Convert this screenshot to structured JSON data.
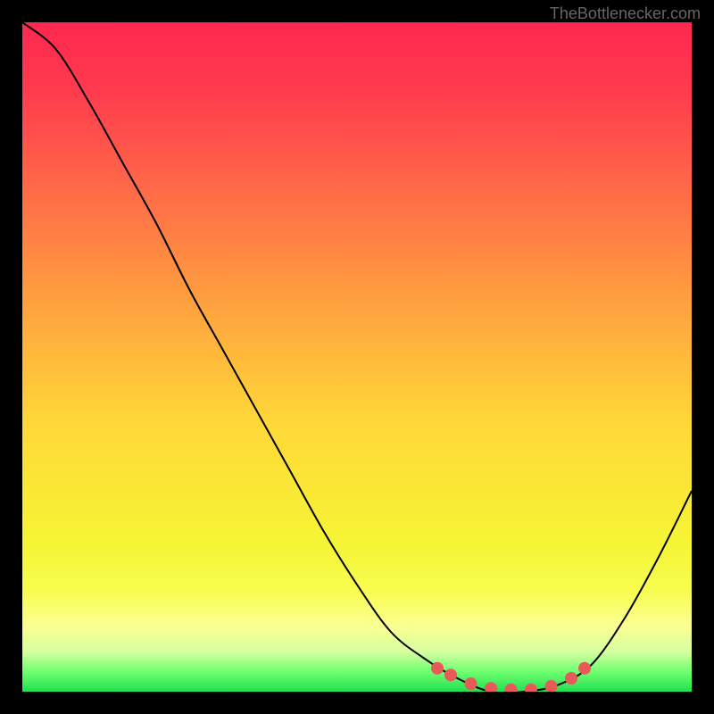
{
  "watermark": "TheBottlenecker.com",
  "chart_data": {
    "type": "line",
    "title": "",
    "xlabel": "",
    "ylabel": "",
    "xlim": [
      0,
      100
    ],
    "ylim": [
      0,
      100
    ],
    "series": [
      {
        "name": "bottleneck-curve",
        "points": [
          {
            "x": 0,
            "y": 100
          },
          {
            "x": 5,
            "y": 96
          },
          {
            "x": 10,
            "y": 88
          },
          {
            "x": 15,
            "y": 79
          },
          {
            "x": 20,
            "y": 70
          },
          {
            "x": 25,
            "y": 60
          },
          {
            "x": 30,
            "y": 51
          },
          {
            "x": 35,
            "y": 42
          },
          {
            "x": 40,
            "y": 33
          },
          {
            "x": 45,
            "y": 24
          },
          {
            "x": 50,
            "y": 16
          },
          {
            "x": 55,
            "y": 9
          },
          {
            "x": 60,
            "y": 5
          },
          {
            "x": 65,
            "y": 2
          },
          {
            "x": 70,
            "y": 0
          },
          {
            "x": 75,
            "y": 0
          },
          {
            "x": 80,
            "y": 1
          },
          {
            "x": 85,
            "y": 4
          },
          {
            "x": 90,
            "y": 11
          },
          {
            "x": 95,
            "y": 20
          },
          {
            "x": 100,
            "y": 30
          }
        ]
      }
    ],
    "gradient_stops": [
      {
        "offset": 0,
        "color": "#ff2850"
      },
      {
        "offset": 10,
        "color": "#ff3a4e"
      },
      {
        "offset": 20,
        "color": "#ff5a4a"
      },
      {
        "offset": 30,
        "color": "#ff7a45"
      },
      {
        "offset": 40,
        "color": "#ff9a40"
      },
      {
        "offset": 50,
        "color": "#ffba3c"
      },
      {
        "offset": 60,
        "color": "#ffd838"
      },
      {
        "offset": 70,
        "color": "#fae835"
      },
      {
        "offset": 78,
        "color": "#f5f535"
      },
      {
        "offset": 85,
        "color": "#f8fd50"
      },
      {
        "offset": 90,
        "color": "#fbff90"
      },
      {
        "offset": 94,
        "color": "#d8ffa0"
      },
      {
        "offset": 97,
        "color": "#70ff70"
      },
      {
        "offset": 100,
        "color": "#20e050"
      }
    ],
    "marker_points": [
      {
        "x": 62,
        "y": 3.5
      },
      {
        "x": 64,
        "y": 2.5
      },
      {
        "x": 67,
        "y": 1.2
      },
      {
        "x": 70,
        "y": 0.5
      },
      {
        "x": 73,
        "y": 0.3
      },
      {
        "x": 76,
        "y": 0.3
      },
      {
        "x": 79,
        "y": 0.8
      },
      {
        "x": 82,
        "y": 2
      },
      {
        "x": 84,
        "y": 3.5
      }
    ],
    "marker_color": "#e85a5a"
  }
}
